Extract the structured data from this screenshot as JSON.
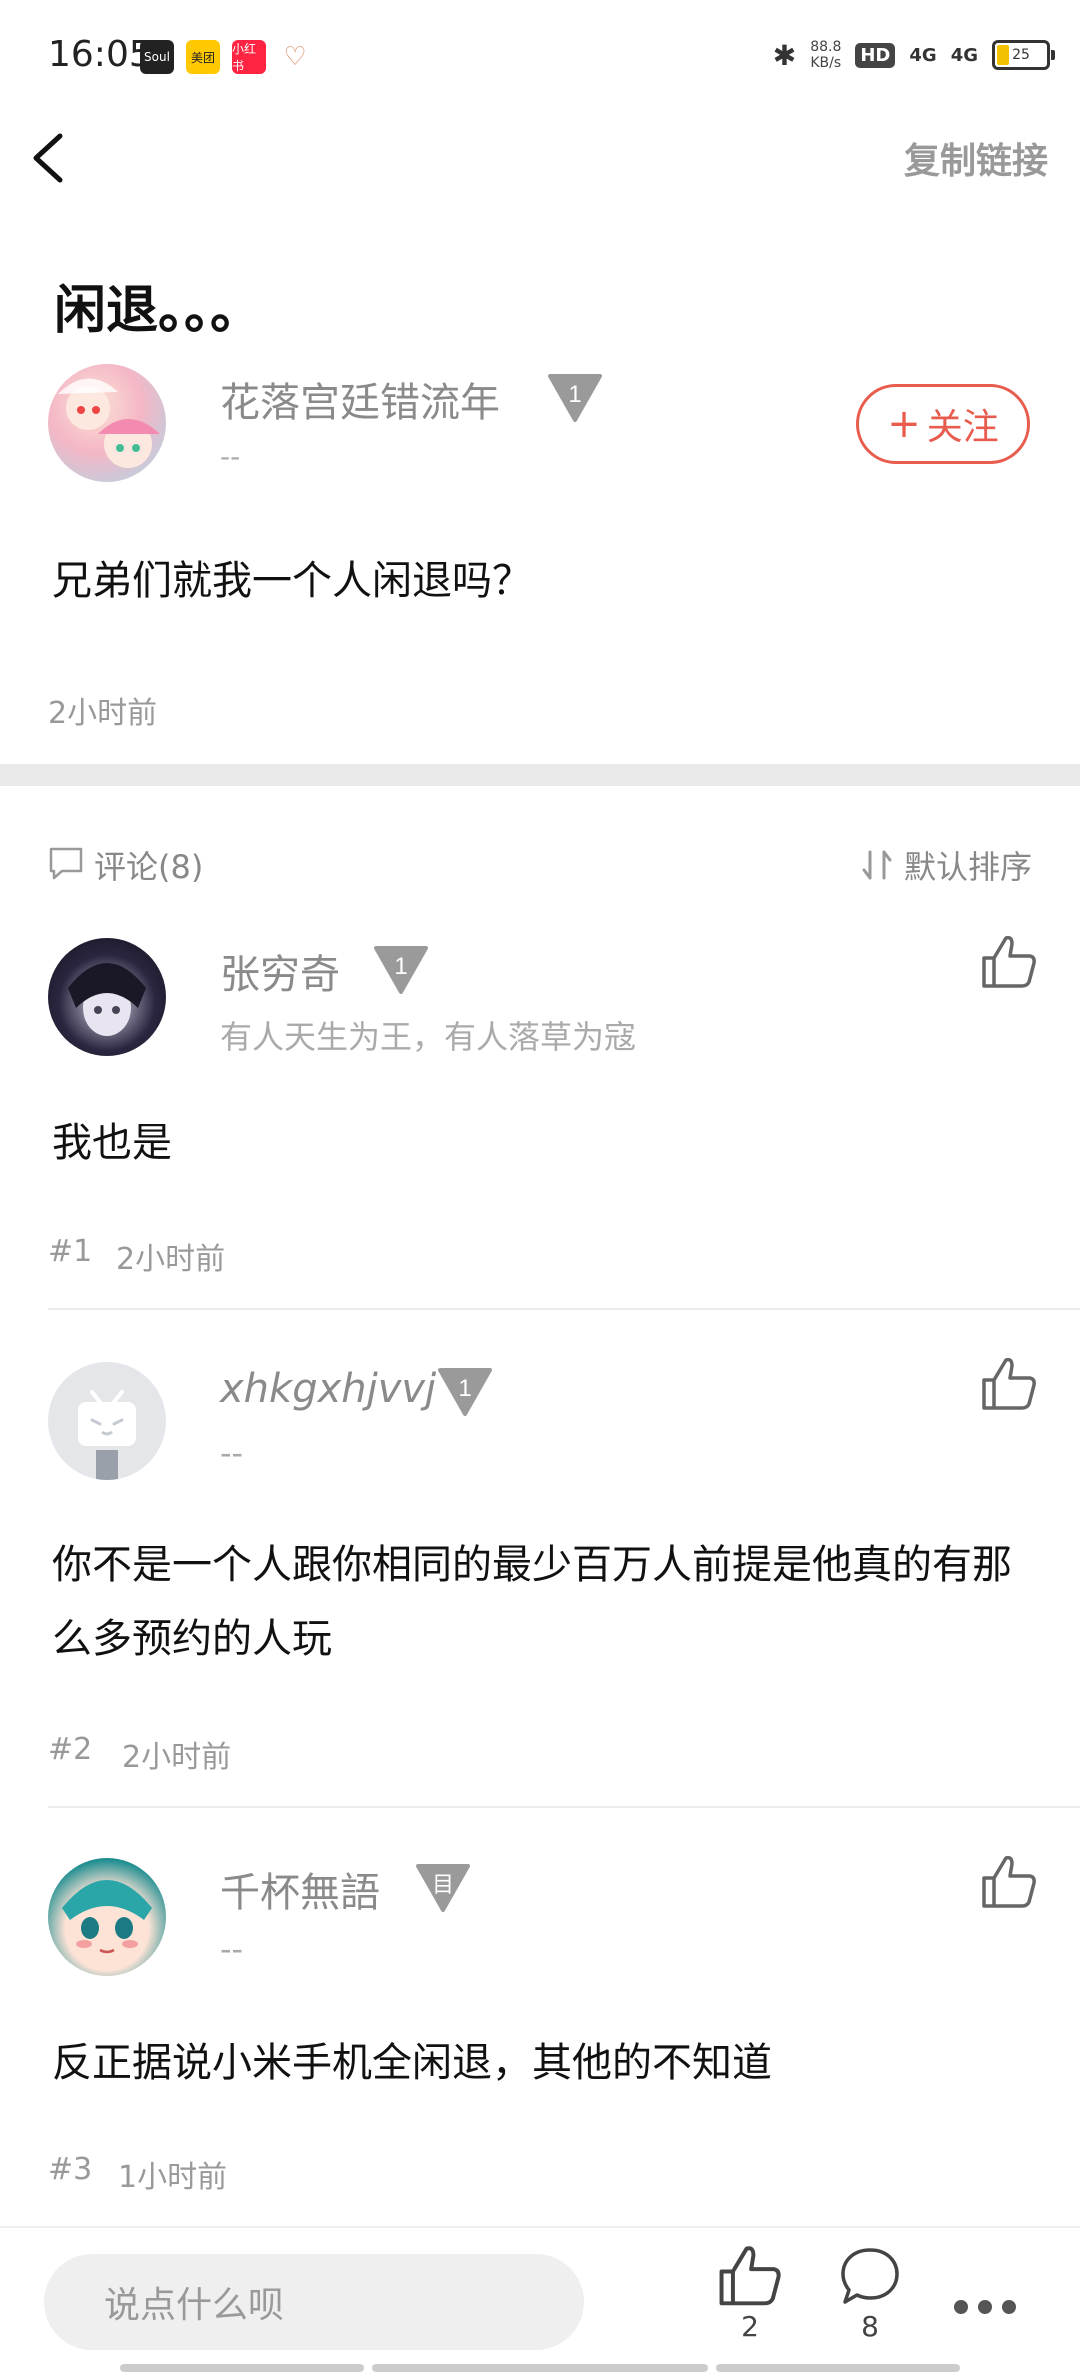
{
  "status_bar": {
    "time": "16:05",
    "apps": [
      "Soul",
      "美团",
      "小红书",
      "♡"
    ],
    "net_speed": "88.8",
    "net_unit": "KB/s",
    "hd": "HD",
    "signal_1": "4G",
    "signal_2": "4G",
    "battery": "25"
  },
  "header": {
    "copy_link": "复制链接"
  },
  "post": {
    "title": "闲退。。。",
    "author_name": "花落宫廷错流年",
    "author_level": "1",
    "author_signature": "--",
    "follow_label": "关注",
    "body": "兄弟们就我一个人闲退吗？",
    "time": "2小时前"
  },
  "comments_header": {
    "label": "评论(8)",
    "sort_label": "默认排序"
  },
  "comments": [
    {
      "name": "张穷奇",
      "level": "1",
      "signature": "有人天生为王，有人落草为寇",
      "body": "我也是",
      "floor": "#1",
      "time": "2小时前"
    },
    {
      "name": "xhkgxhjvvj",
      "level": "1",
      "signature": "--",
      "body": "你不是一个人跟你相同的最少百万人前提是他真的有那么多预约的人玩",
      "floor": "#2",
      "time": "2小时前"
    },
    {
      "name": "千杯無語",
      "level": "目",
      "signature": "--",
      "body": "反正据说小米手机全闲退，其他的不知道",
      "floor": "#3",
      "time": "1小时前"
    }
  ],
  "bottom_bar": {
    "input_placeholder": "说点什么呗",
    "like_count": "2",
    "comment_count": "8"
  },
  "colors": {
    "accent": "#e85c4e",
    "level_badge": "#9a9a9a"
  }
}
